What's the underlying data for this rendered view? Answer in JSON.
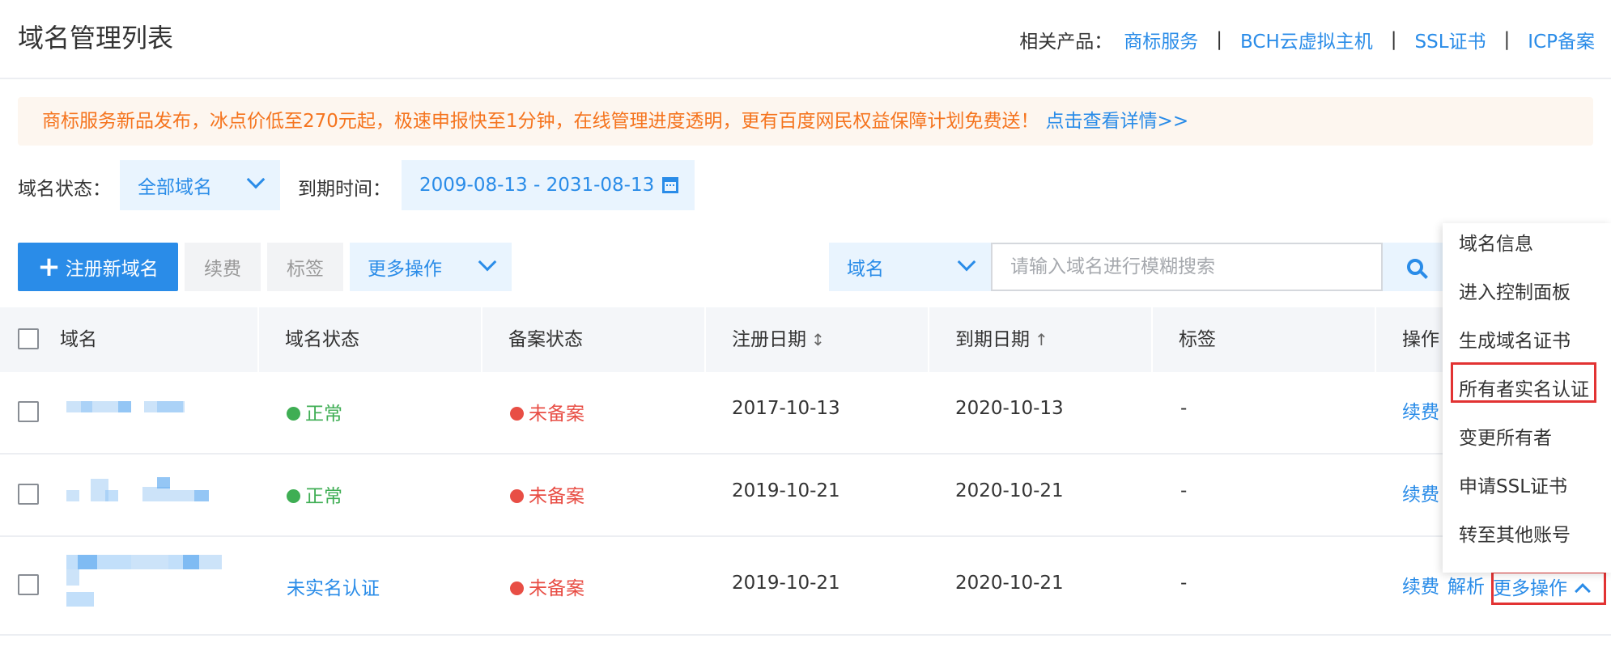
{
  "header": {
    "title": "域名管理列表",
    "related_label": "相关产品：",
    "related_links": [
      "商标服务",
      "BCH云虚拟主机",
      "SSL证书",
      "ICP备案"
    ],
    "separator": "|"
  },
  "notice": {
    "text": "商标服务新品发布，冰点价低至270元起，极速申报快至1分钟，在线管理进度透明，更有百度网民权益保障计划免费送！",
    "link": "点击查看详情>>"
  },
  "filters": {
    "status_label": "域名状态：",
    "status_value": "全部域名",
    "expire_label": "到期时间：",
    "expire_range": "2009-08-13 - 2031-08-13"
  },
  "actions": {
    "register": "注册新域名",
    "renew": "续费",
    "tag": "标签",
    "more": "更多操作"
  },
  "search": {
    "type": "域名",
    "placeholder": "请输入域名进行模糊搜索"
  },
  "table": {
    "headers": [
      "域名",
      "域名状态",
      "备案状态",
      "注册日期",
      "到期日期",
      "标签",
      "操作"
    ],
    "rows": [
      {
        "status": "正常",
        "record": "未备案",
        "reg": "2017-10-13",
        "exp": "2020-10-13",
        "tag": "-",
        "op1": "续费"
      },
      {
        "status": "正常",
        "record": "未备案",
        "reg": "2019-10-21",
        "exp": "2020-10-21",
        "tag": "-",
        "op1": "续费"
      },
      {
        "status": "未实名认证",
        "record": "未备案",
        "reg": "2019-10-21",
        "exp": "2020-10-21",
        "tag": "-",
        "op1": "续费",
        "op2": "解析",
        "op3": "更多操作"
      }
    ]
  },
  "dropdown": {
    "items": [
      "域名信息",
      "进入控制面板",
      "生成域名证书",
      "所有者实名认证",
      "变更所有者",
      "申请SSL证书",
      "转至其他账号"
    ]
  },
  "colors": {
    "accent": "#2a8ce8",
    "ok": "#3fae54",
    "error": "#e84e45",
    "notice_text": "#f5741e",
    "highlight": "#e23333"
  }
}
